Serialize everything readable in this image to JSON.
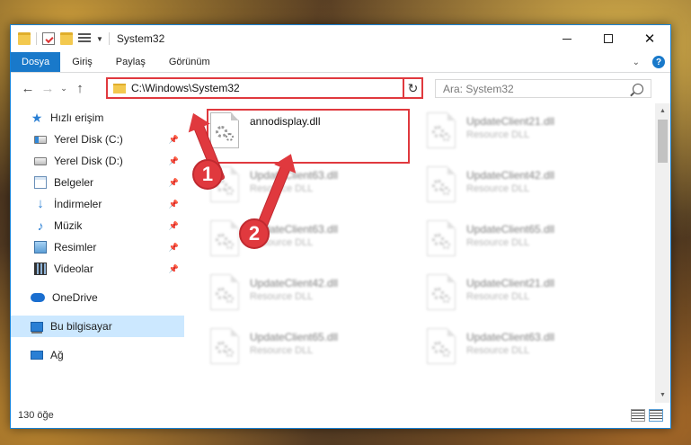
{
  "window": {
    "title": "System32"
  },
  "ribbon": {
    "tabs": [
      "Dosya",
      "Giriş",
      "Paylaş",
      "Görünüm"
    ]
  },
  "address": {
    "path": "C:\\Windows\\System32"
  },
  "search": {
    "placeholder": "Ara: System32"
  },
  "nav": {
    "quick_access": "Hızlı erişim",
    "items": [
      {
        "label": "Yerel Disk (C:)",
        "icon": "drive-c-icon"
      },
      {
        "label": "Yerel Disk (D:)",
        "icon": "drive-icon"
      },
      {
        "label": "Belgeler",
        "icon": "documents-icon"
      },
      {
        "label": "İndirmeler",
        "icon": "downloads-icon"
      },
      {
        "label": "Müzik",
        "icon": "music-icon"
      },
      {
        "label": "Resimler",
        "icon": "pictures-icon"
      },
      {
        "label": "Videolar",
        "icon": "videos-icon"
      }
    ],
    "onedrive": "OneDrive",
    "this_pc": "Bu bilgisayar",
    "network": "Ağ"
  },
  "files": [
    {
      "name": "annodisplay.dll",
      "type": ""
    },
    {
      "name": "UpdateClient21.dll",
      "type": "Resource DLL"
    },
    {
      "name": "UpdateClient63.dll",
      "type": "Resource DLL"
    },
    {
      "name": "UpdateClient42.dll",
      "type": "Resource DLL"
    },
    {
      "name": "UpdateClient63.dll",
      "type": "Resource DLL"
    },
    {
      "name": "UpdateClient65.dll",
      "type": "Resource DLL"
    },
    {
      "name": "UpdateClient42.dll",
      "type": "Resource DLL"
    },
    {
      "name": "UpdateClient21.dll",
      "type": "Resource DLL"
    },
    {
      "name": "UpdateClient65.dll",
      "type": "Resource DLL"
    },
    {
      "name": "UpdateClient63.dll",
      "type": "Resource DLL"
    }
  ],
  "status": {
    "count": "130 öğe"
  },
  "annotations": {
    "step1": "1",
    "step2": "2",
    "color": "#e0393e"
  }
}
